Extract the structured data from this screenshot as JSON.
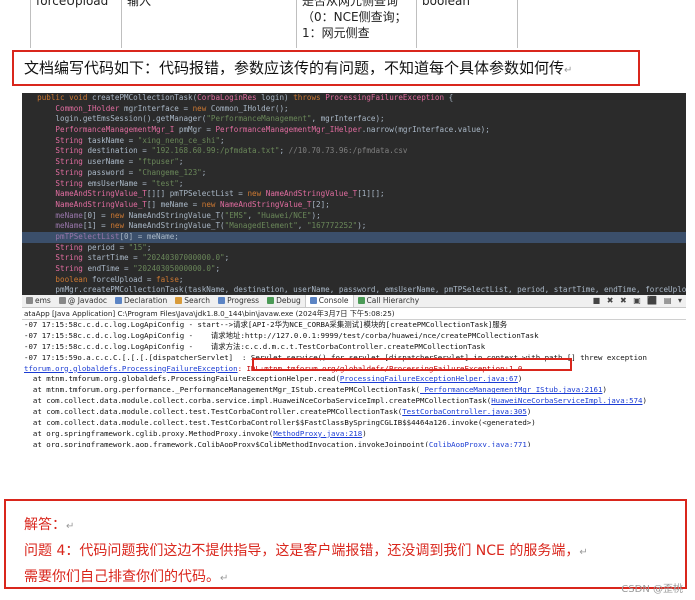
{
  "doc_table": {
    "cells": [
      "forceUpload",
      "输入",
      "是否从网元侧查询\n（0：NCE侧查询；\n1：网元侧查",
      "boolean"
    ]
  },
  "question": "文档编写代码如下：代码报错，参数应该传的有问题，不知道每个具体参数如何传",
  "editor": {
    "lines": [
      [
        {
          "c": "kw",
          "t": "  public void "
        },
        {
          "c": "tx",
          "t": "createPMCollectionTask("
        },
        {
          "c": "ty",
          "t": "CorbaLoginRes"
        },
        {
          "c": "tx",
          "t": " login) "
        },
        {
          "c": "kw",
          "t": "throws "
        },
        {
          "c": "ty",
          "t": "ProcessingFailureException"
        },
        {
          "c": "tx",
          "t": " {"
        }
      ],
      [
        {
          "c": "ty",
          "t": "      Common_IHolder"
        },
        {
          "c": "tx",
          "t": " mgrInterface = "
        },
        {
          "c": "kw",
          "t": "new "
        },
        {
          "c": "tx",
          "t": "Common_IHolder();"
        }
      ],
      [
        {
          "c": "tx",
          "t": "      login.getEmsSession().getManager("
        },
        {
          "c": "st",
          "t": "\"PerformanceManagement\""
        },
        {
          "c": "tx",
          "t": ", mgrInterface);"
        }
      ],
      [
        {
          "c": "ty",
          "t": "      PerformanceManagementMgr_I"
        },
        {
          "c": "tx",
          "t": " pmMgr = "
        },
        {
          "c": "ty",
          "t": "PerformanceManagementMgr_IHelper"
        },
        {
          "c": "tx",
          "t": ".narrow(mgrInterface.value);"
        }
      ],
      [
        {
          "c": "ty",
          "t": "      String"
        },
        {
          "c": "tx",
          "t": " taskName = "
        },
        {
          "c": "st",
          "t": "\"xing_neng_ce_shi\""
        },
        {
          "c": "tx",
          "t": ";"
        }
      ],
      [
        {
          "c": "ty",
          "t": "      String"
        },
        {
          "c": "tx",
          "t": " destination = "
        },
        {
          "c": "st",
          "t": "\"192.168.60.99:/pfmdata.txt\""
        },
        {
          "c": "tx",
          "t": "; "
        },
        {
          "c": "cm",
          "t": "//10.70.73.96:/pfmdata.csv"
        }
      ],
      [
        {
          "c": "ty",
          "t": "      String"
        },
        {
          "c": "tx",
          "t": " userName = "
        },
        {
          "c": "st",
          "t": "\"ftpuser\""
        },
        {
          "c": "tx",
          "t": ";"
        }
      ],
      [
        {
          "c": "ty",
          "t": "      String"
        },
        {
          "c": "tx",
          "t": " password = "
        },
        {
          "c": "st",
          "t": "\"Changeme_123\""
        },
        {
          "c": "tx",
          "t": ";"
        }
      ],
      [
        {
          "c": "ty",
          "t": "      String"
        },
        {
          "c": "tx",
          "t": " emsUserName = "
        },
        {
          "c": "st",
          "t": "\"test\""
        },
        {
          "c": "tx",
          "t": ";"
        }
      ],
      [
        {
          "c": "ty",
          "t": "      NameAndStringValue_T"
        },
        {
          "c": "tx",
          "t": "[][] pmTPSelectList = "
        },
        {
          "c": "kw",
          "t": "new "
        },
        {
          "c": "ty",
          "t": "NameAndStringValue_T"
        },
        {
          "c": "tx",
          "t": "[1][];"
        }
      ],
      [
        {
          "c": "ty",
          "t": "      NameAndStringValue_T"
        },
        {
          "c": "tx",
          "t": "[] meName = "
        },
        {
          "c": "kw",
          "t": "new "
        },
        {
          "c": "ty",
          "t": "NameAndStringValue_T"
        },
        {
          "c": "tx",
          "t": "[2];"
        }
      ],
      [
        {
          "c": "vr",
          "t": "      meName"
        },
        {
          "c": "tx",
          "t": "[0] = "
        },
        {
          "c": "kw",
          "t": "new "
        },
        {
          "c": "tx",
          "t": "NameAndStringValue_T("
        },
        {
          "c": "st",
          "t": "\"EMS\""
        },
        {
          "c": "tx",
          "t": ", "
        },
        {
          "c": "st",
          "t": "\"Huawei/NCE\""
        },
        {
          "c": "tx",
          "t": ");"
        }
      ],
      [
        {
          "c": "vr",
          "t": "      meName"
        },
        {
          "c": "tx",
          "t": "[1] = "
        },
        {
          "c": "kw",
          "t": "new "
        },
        {
          "c": "tx",
          "t": "NameAndStringValue_T("
        },
        {
          "c": "st",
          "t": "\"ManagedElement\""
        },
        {
          "c": "tx",
          "t": ", "
        },
        {
          "c": "st",
          "t": "\"167772252\""
        },
        {
          "c": "tx",
          "t": ");"
        }
      ],
      [
        {
          "c": "vr",
          "t": "      pmTPSelectList"
        },
        {
          "c": "tx",
          "t": "[0] = meName;"
        }
      ],
      [
        {
          "c": "ty",
          "t": "      String"
        },
        {
          "c": "tx",
          "t": " period = "
        },
        {
          "c": "st",
          "t": "\"15\""
        },
        {
          "c": "tx",
          "t": ";"
        }
      ],
      [
        {
          "c": "ty",
          "t": "      String"
        },
        {
          "c": "tx",
          "t": " startTime = "
        },
        {
          "c": "st",
          "t": "\"20240307000000.0\""
        },
        {
          "c": "tx",
          "t": ";"
        }
      ],
      [
        {
          "c": "ty",
          "t": "      String"
        },
        {
          "c": "tx",
          "t": " endTime = "
        },
        {
          "c": "st",
          "t": "\"20240305000000.0\""
        },
        {
          "c": "tx",
          "t": ";"
        }
      ],
      [
        {
          "c": "kw",
          "t": "      boolean "
        },
        {
          "c": "tx",
          "t": "forceUpload = "
        },
        {
          "c": "kw",
          "t": "false"
        },
        {
          "c": "tx",
          "t": ";"
        }
      ],
      [
        {
          "c": "tx",
          "t": "      pmMgr.createPMCollectionTask(taskName, destination, userName, password, emsUserName, pmTPSelectList, period, startTime, endTime, forceUpload);"
        }
      ]
    ],
    "highlight_line": 13
  },
  "console": {
    "tabs": [
      {
        "label": "ems",
        "icon": "problems-icon",
        "color": "gray"
      },
      {
        "label": "@ Javadoc",
        "icon": "javadoc-icon",
        "color": "gray"
      },
      {
        "label": "Declaration",
        "icon": "declaration-icon",
        "color": "blue"
      },
      {
        "label": "Search",
        "icon": "search-icon",
        "color": "orange"
      },
      {
        "label": "Progress",
        "icon": "progress-icon",
        "color": "blue"
      },
      {
        "label": "Debug",
        "icon": "debug-icon",
        "color": "green"
      },
      {
        "label": "Console",
        "icon": "console-icon",
        "color": "blue",
        "active": true
      },
      {
        "label": "Call Hierarchy",
        "icon": "call-hierarchy-icon",
        "color": "green"
      }
    ],
    "toolbar_icons": "■ ✖ ✖ ▣ ⬛ ▤ ▾",
    "launch": "ataApp [Java Application] C:\\Program Files\\Java\\jdk1.8.0_144\\bin\\javaw.exe (2024年3月7日 下午5:08:25)",
    "lines": [
      {
        "t": "-07 17:15:58c.c.d.c.log.LogApiConfig - start-->请求[API-2华为NCE_CORBA采集测试]模块的[createPMCollectionTask]服务"
      },
      {
        "t": "-07 17:15:58c.c.d.c.log.LogApiConfig -    请求地址:http://127.0.0.1:9999/test/corba/huawei/nce/createPMCollectionTask"
      },
      {
        "t": "-07 17:15:58c.c.d.c.log.LogApiConfig -    请求方法:c.c.d.m.c.t.TestCorbaController.createPMCollectionTask"
      },
      {
        "t": "-07 17:15:59o.a.c.c.C.[.[.[.[dispatcherServlet]  : Servlet.service() for servlet [dispatcherServlet] in context with path [] threw exception"
      },
      {
        "t": "tforum.org.globaldefs.ProcessingFailureException: IDL:mtnm.tmforum.org/globaldefs/ProcessingFailureException:1.0",
        "err": true
      },
      {
        "t": "  at mtnm.tmforum.org.globaldefs.ProcessingFailureExceptionHelper.read(ProcessingFailureExceptionHelper.java:67)"
      },
      {
        "t": "  at mtnm.tmforum.org.performance._PerformanceManagementMgr_IStub.createPMCollectionTask(_PerformanceManagementMgr_IStub.java:2161)"
      },
      {
        "t": "  at com.collect.data.module.collect.corba.service.impl.HuaweiNceCorbaServiceImpl.createPMCollectionTask(HuaweiNceCorbaServiceImpl.java:574)"
      },
      {
        "t": "  at com.collect.data.module.collect.test.TestCorbaController.createPMCollectionTask(TestCorbaController.java:305)"
      },
      {
        "t": "  at com.collect.data.module.collect.test.TestCorbaController$$FastClassBySpringCGLIB$$4464a126.invoke(<generated>)"
      },
      {
        "t": "  at org.springframework.cglib.proxy.MethodProxy.invoke(MethodProxy.java:218)"
      },
      {
        "t": "  at org.springframework.aop.framework.CglibAopProxy$CglibMethodInvocation.invokeJoinpoint(CglibAopProxy.java:771)"
      }
    ]
  },
  "answer": {
    "label": "解答：",
    "line1": "问题 4：代码问题我们这边不提供指导，这是客户端报错，还没调到我们 NCE 的服务端，",
    "line2": "需要你们自己排查你们的代码。"
  },
  "watermark": "CSDN @歪桃"
}
